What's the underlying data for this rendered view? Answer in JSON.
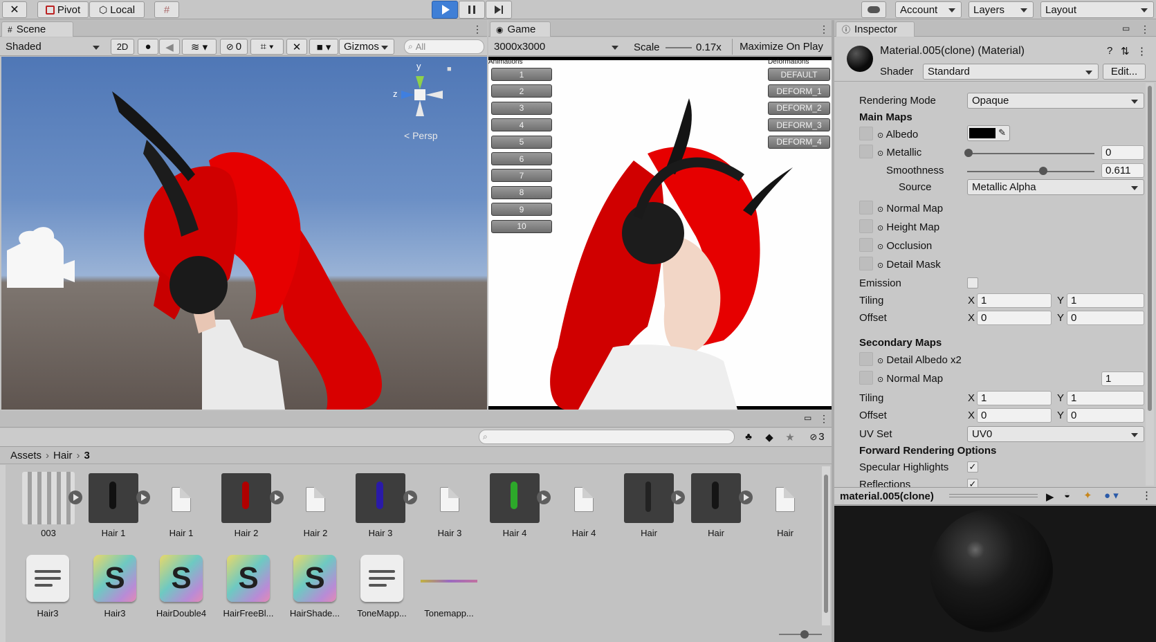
{
  "toolbar": {
    "pivot": "Pivot",
    "local": "Local",
    "account": "Account",
    "layers": "Layers",
    "layout": "Layout"
  },
  "scene": {
    "tab": "Scene",
    "shading": "Shaded",
    "mode2d": "2D",
    "hidden_count": "0",
    "gizmos": "Gizmos",
    "search_placeholder": "All",
    "axis_y": "y",
    "axis_z": "z",
    "persp": "Persp"
  },
  "game": {
    "tab": "Game",
    "resolution": "3000x3000",
    "scale_label": "Scale",
    "scale_value": "0.17x",
    "maximize": "Maximize On Play",
    "animations_title": "Animations",
    "deformations_title": "Deformations",
    "animation_buttons": [
      "1",
      "2",
      "3",
      "4",
      "5",
      "6",
      "7",
      "8",
      "9",
      "10"
    ],
    "deformation_buttons": [
      "DEFAULT",
      "DEFORM_1",
      "DEFORM_2",
      "DEFORM_3",
      "DEFORM_4"
    ]
  },
  "project": {
    "hidden_count": "3",
    "breadcrumb": [
      "Assets",
      "Hair",
      "3"
    ],
    "row1": [
      "003",
      "Hair 1",
      "Hair 1",
      "Hair 2",
      "Hair 2",
      "Hair 3",
      "Hair 3",
      "Hair 4",
      "Hair 4",
      "Hair",
      "Hair",
      "Hair"
    ],
    "row2": [
      "Hair3",
      "Hair3",
      "HairDouble4",
      "HairFreeBl...",
      "HairShade...",
      "ToneMapp...",
      "Tonemapp..."
    ]
  },
  "inspector": {
    "tab": "Inspector",
    "title": "Material.005(clone) (Material)",
    "shader_label": "Shader",
    "shader_value": "Standard",
    "edit": "Edit...",
    "rendering_mode_label": "Rendering Mode",
    "rendering_mode_value": "Opaque",
    "main_maps": "Main Maps",
    "albedo": "Albedo",
    "albedo_color": "#000000",
    "metallic": "Metallic",
    "metallic_value": "0",
    "smoothness": "Smoothness",
    "smoothness_value": "0.611",
    "source_label": "Source",
    "source_value": "Metallic Alpha",
    "normal_map": "Normal Map",
    "height_map": "Height Map",
    "occlusion": "Occlusion",
    "detail_mask": "Detail Mask",
    "emission": "Emission",
    "tiling": "Tiling",
    "offset": "Offset",
    "x": "X",
    "y": "Y",
    "tiling_x": "1",
    "tiling_y": "1",
    "offset_x": "0",
    "offset_y": "0",
    "secondary_maps": "Secondary Maps",
    "detail_albedo": "Detail Albedo x2",
    "normal_map2": "Normal Map",
    "normal_map2_value": "1",
    "tiling2_x": "1",
    "tiling2_y": "1",
    "offset2_x": "0",
    "offset2_y": "0",
    "uv_set_label": "UV Set",
    "uv_set_value": "UV0",
    "forward_rendering": "Forward Rendering Options",
    "specular_highlights": "Specular Highlights",
    "reflections": "Reflections",
    "check": "✓",
    "preview_name": "material.005(clone)"
  },
  "colors": {
    "play_active": "#3f7fd6",
    "hair_red": "#e0000a"
  }
}
